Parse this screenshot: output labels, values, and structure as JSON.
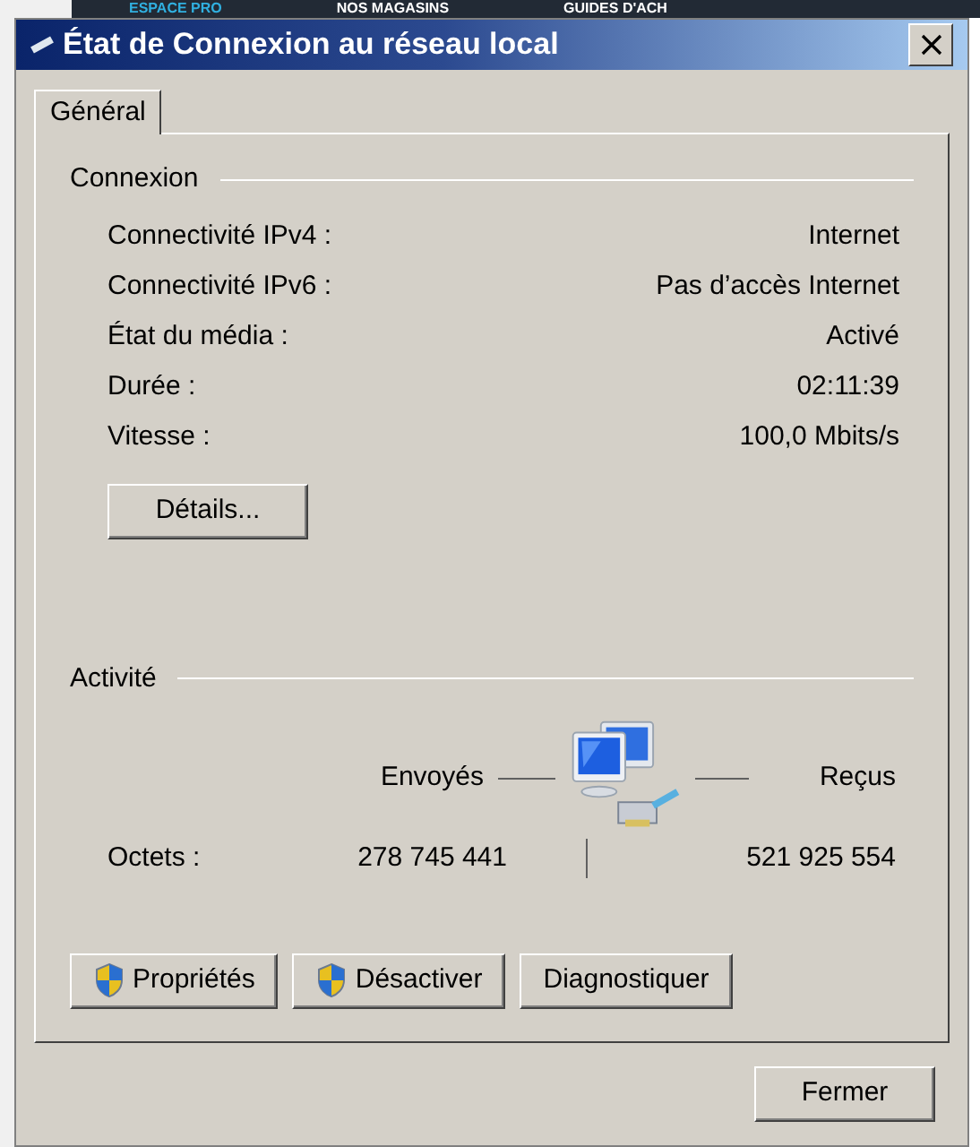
{
  "background_nav": [
    "ESPACE PRO",
    "NOS MAGASINS",
    "GUIDES D'ACH"
  ],
  "window": {
    "title": "État de Connexion au réseau local"
  },
  "tabs": [
    {
      "label": "Général",
      "selected": true
    }
  ],
  "connection": {
    "heading": "Connexion",
    "rows": [
      {
        "label": "Connectivité IPv4 :",
        "value": "Internet"
      },
      {
        "label": "Connectivité IPv6 :",
        "value": "Pas d’accès Internet"
      },
      {
        "label": "État du média :",
        "value": "Activé"
      },
      {
        "label": "Durée :",
        "value": "02:11:39"
      },
      {
        "label": "Vitesse :",
        "value": "100,0 Mbits/s"
      }
    ],
    "details_button": "Détails..."
  },
  "activity": {
    "heading": "Activité",
    "sent_label": "Envoyés",
    "received_label": "Reçus",
    "bytes_label": "Octets :",
    "sent": "278 745 441",
    "received": "521 925 554"
  },
  "buttons": [
    {
      "label": "Propriétés",
      "shield": true
    },
    {
      "label": "Désactiver",
      "shield": true
    },
    {
      "label": "Diagnostiquer",
      "shield": false
    }
  ],
  "close_button": "Fermer"
}
